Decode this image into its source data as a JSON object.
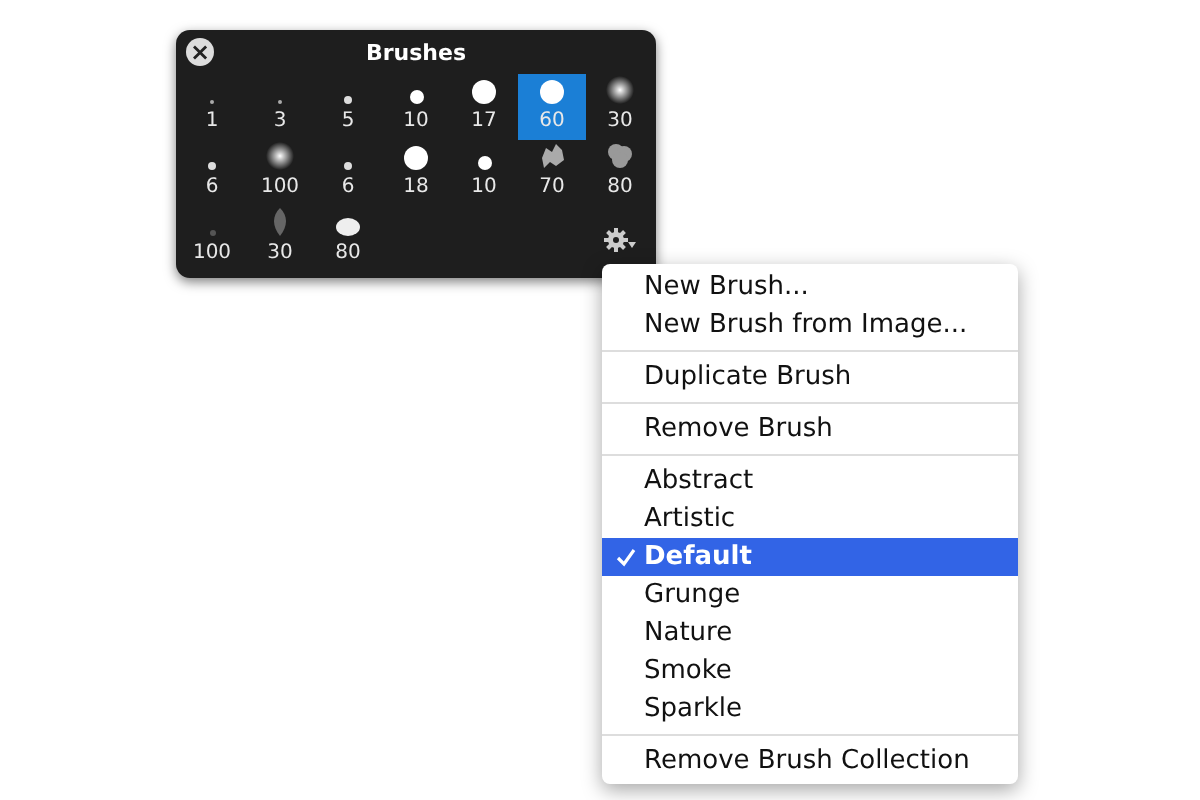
{
  "panel": {
    "title": "Brushes",
    "close": "×",
    "brushes": [
      {
        "label": "1",
        "kind": "tiny",
        "selected": false
      },
      {
        "label": "3",
        "kind": "tiny",
        "selected": false
      },
      {
        "label": "5",
        "kind": "small",
        "selected": false
      },
      {
        "label": "10",
        "kind": "medium",
        "selected": false
      },
      {
        "label": "17",
        "kind": "large",
        "selected": false
      },
      {
        "label": "60",
        "kind": "large",
        "selected": true
      },
      {
        "label": "30",
        "kind": "soft",
        "selected": false
      },
      {
        "label": "6",
        "kind": "small",
        "selected": false
      },
      {
        "label": "100",
        "kind": "soft",
        "selected": false
      },
      {
        "label": "6",
        "kind": "small",
        "selected": false
      },
      {
        "label": "18",
        "kind": "large",
        "selected": false
      },
      {
        "label": "10",
        "kind": "medium",
        "selected": false
      },
      {
        "label": "70",
        "kind": "splatter",
        "selected": false
      },
      {
        "label": "80",
        "kind": "cloud",
        "selected": false
      },
      {
        "label": "100",
        "kind": "faint",
        "selected": false
      },
      {
        "label": "30",
        "kind": "leaf",
        "selected": false
      },
      {
        "label": "80",
        "kind": "oval",
        "selected": false
      }
    ]
  },
  "menu": {
    "sections": [
      [
        {
          "label": "New Brush...",
          "selected": false,
          "checked": false
        },
        {
          "label": "New Brush from Image...",
          "selected": false,
          "checked": false
        }
      ],
      [
        {
          "label": "Duplicate Brush",
          "selected": false,
          "checked": false
        }
      ],
      [
        {
          "label": "Remove Brush",
          "selected": false,
          "checked": false
        }
      ],
      [
        {
          "label": "Abstract",
          "selected": false,
          "checked": false
        },
        {
          "label": "Artistic",
          "selected": false,
          "checked": false
        },
        {
          "label": "Default",
          "selected": true,
          "checked": true
        },
        {
          "label": "Grunge",
          "selected": false,
          "checked": false
        },
        {
          "label": "Nature",
          "selected": false,
          "checked": false
        },
        {
          "label": "Smoke",
          "selected": false,
          "checked": false
        },
        {
          "label": "Sparkle",
          "selected": false,
          "checked": false
        }
      ],
      [
        {
          "label": "Remove Brush Collection",
          "selected": false,
          "checked": false
        }
      ]
    ]
  }
}
